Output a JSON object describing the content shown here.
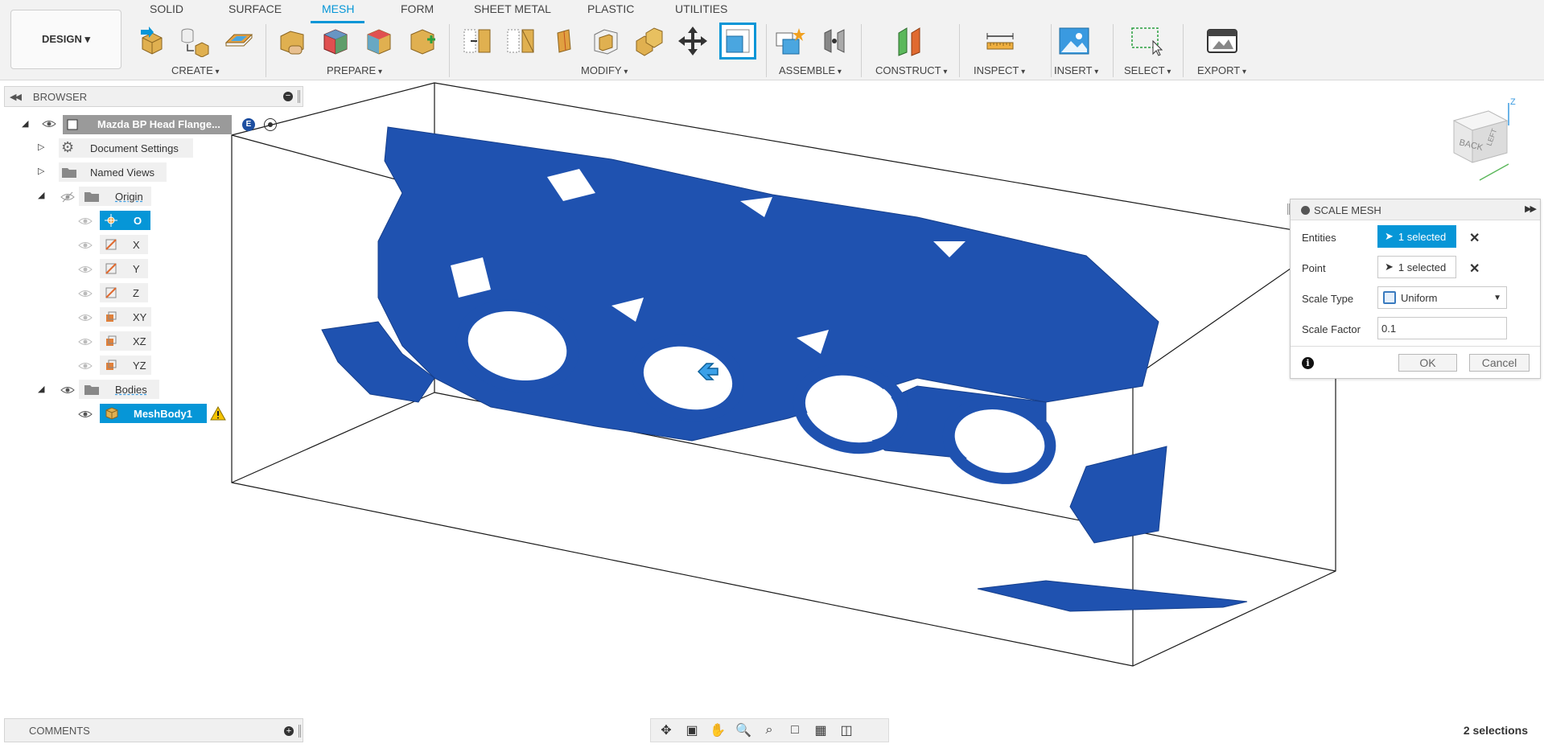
{
  "toolbar": {
    "workspace": "DESIGN ▾",
    "tabs": [
      "SOLID",
      "SURFACE",
      "MESH",
      "FORM",
      "SHEET METAL",
      "PLASTIC",
      "UTILITIES"
    ],
    "active_tab": "MESH",
    "groups": [
      "CREATE",
      "PREPARE",
      "MODIFY",
      "ASSEMBLE",
      "CONSTRUCT",
      "INSPECT",
      "INSERT",
      "SELECT",
      "EXPORT"
    ]
  },
  "browser": {
    "title": "BROWSER",
    "root": "Mazda BP Head Flange...",
    "items": [
      {
        "label": "Document Settings"
      },
      {
        "label": "Named Views"
      },
      {
        "label": "Origin"
      },
      {
        "label": "O"
      },
      {
        "label": "X"
      },
      {
        "label": "Y"
      },
      {
        "label": "Z"
      },
      {
        "label": "XY"
      },
      {
        "label": "XZ"
      },
      {
        "label": "YZ"
      },
      {
        "label": "Bodies"
      },
      {
        "label": "MeshBody1"
      }
    ]
  },
  "dialog": {
    "title": "SCALE MESH",
    "entities_label": "Entities",
    "entities_value": "1 selected",
    "point_label": "Point",
    "point_value": "1 selected",
    "scale_type_label": "Scale Type",
    "scale_type_value": "Uniform",
    "scale_factor_label": "Scale Factor",
    "scale_factor_value": "0.1",
    "ok_label": "OK",
    "cancel_label": "Cancel"
  },
  "viewcube": {
    "back": "BACK",
    "left": "LEFT",
    "axis": "Z"
  },
  "comments": {
    "title": "COMMENTS"
  },
  "status": {
    "selections": "2 selections"
  },
  "colors": {
    "accent": "#0696d7",
    "mesh": "#1f52b0",
    "warning": "#f5c400"
  }
}
